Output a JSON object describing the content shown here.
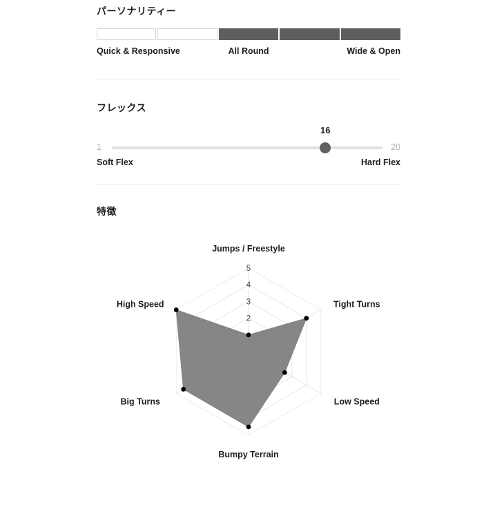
{
  "personality": {
    "title": "パーソナリティー",
    "segments": [
      {
        "filled": false
      },
      {
        "filled": false
      },
      {
        "filled": true
      },
      {
        "filled": true
      },
      {
        "filled": true
      }
    ],
    "filled_count": 3,
    "total_segments": 5,
    "label_start": "Quick & Responsive",
    "label_mid": "All Round",
    "label_end": "Wide & Open",
    "fill_color": "#5e5e5e",
    "empty_color": "#ffffff",
    "border_color": "#d6d6d6"
  },
  "flex": {
    "title": "フレックス",
    "min": "1",
    "max": "20",
    "value": "16",
    "value_percent": 78.9,
    "label_start": "Soft Flex",
    "label_end": "Hard Flex",
    "track_color": "#e2e2e2",
    "thumb_color": "#616161"
  },
  "features": {
    "title": "特徴"
  },
  "chart_data": {
    "type": "radar",
    "title": "特徴",
    "categories": [
      "Jumps / Freestyle",
      "Tight Turns",
      "Low Speed",
      "Bumpy Terrain",
      "Big Turns",
      "High Speed"
    ],
    "values": [
      1,
      4,
      2.5,
      4.5,
      4.5,
      5
    ],
    "rmin": 0,
    "rmax": 5,
    "tick_labels": [
      "2",
      "3",
      "4",
      "5"
    ],
    "tick_values": [
      2,
      3,
      4,
      5
    ],
    "grid": true,
    "legend": "none",
    "series": [
      {
        "name": "特徴",
        "values": [
          1,
          4,
          2.5,
          4.5,
          4.5,
          5
        ],
        "fill": "#808080",
        "fill_opacity": 0.95,
        "point_color": "#000000"
      }
    ],
    "grid_color": "#e6e6e6",
    "axis_color": "#ececec"
  }
}
